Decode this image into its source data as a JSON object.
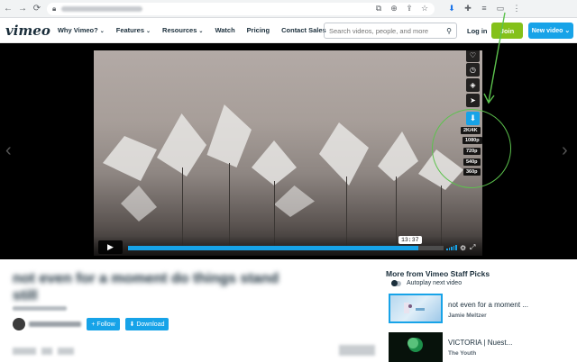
{
  "browser": {
    "icons": [
      "back-icon",
      "forward-icon",
      "reload-icon",
      "lock-icon",
      "translate-icon",
      "zoom-icon",
      "share-icon",
      "star-icon",
      "download-extension-icon",
      "puzzle-icon",
      "reading-list-icon",
      "sidebar-icon",
      "menu-icon"
    ]
  },
  "header": {
    "logo": "vimeo",
    "nav": [
      {
        "label": "Why Vimeo?",
        "chevron": true
      },
      {
        "label": "Features",
        "chevron": true
      },
      {
        "label": "Resources",
        "chevron": true
      },
      {
        "label": "Watch",
        "chevron": false
      },
      {
        "label": "Pricing",
        "chevron": false
      },
      {
        "label": "Contact Sales",
        "chevron": false
      }
    ],
    "search_placeholder": "Search videos, people, and more",
    "login_label": "Log in",
    "join_label": "Join",
    "new_video_label": "New video"
  },
  "player": {
    "timecode": "13:37",
    "progress": 0.92,
    "quality_options": [
      "2K/4K",
      "1080p",
      "720p",
      "540p",
      "360p"
    ],
    "accent_color": "#17a3e8"
  },
  "video_info": {
    "title": "not even for a moment do things stand still",
    "follow_label": "Follow",
    "download_label": "Download"
  },
  "sidebar": {
    "heading": "More from Vimeo Staff Picks",
    "autoplay_label": "Autoplay next video",
    "items": [
      {
        "title": "not even for a moment ...",
        "author": "Jamie Meltzer"
      },
      {
        "title": "VICTORIA | Nuest...",
        "author": "The Youth"
      }
    ]
  },
  "annotation_color": "#5cc24d"
}
